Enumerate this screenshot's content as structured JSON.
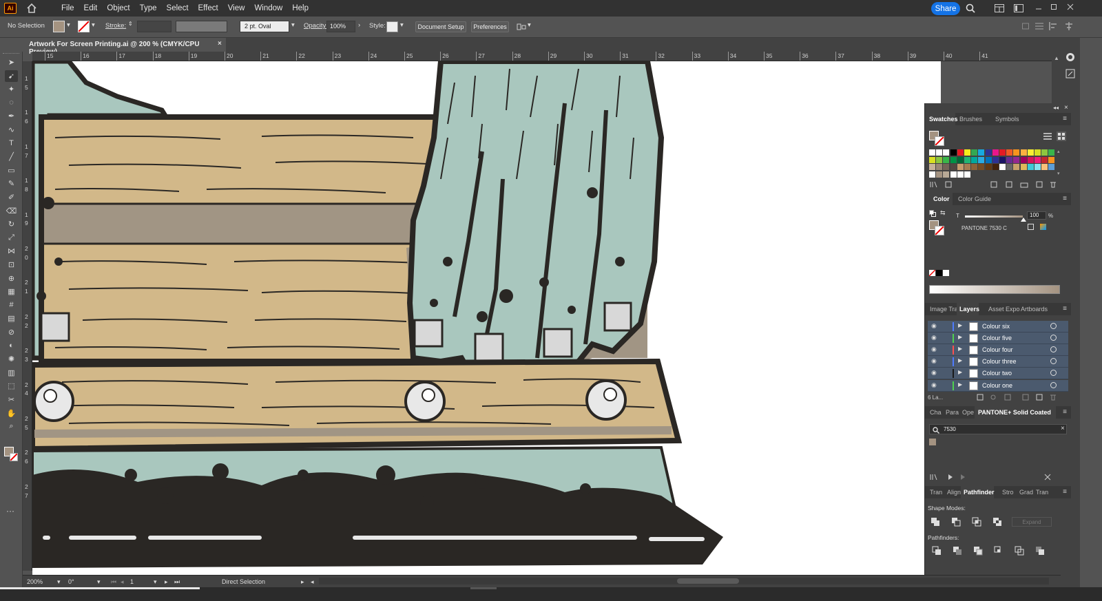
{
  "app": {
    "logo": "Ai",
    "share_label": "Share"
  },
  "menu": [
    "File",
    "Edit",
    "Object",
    "Type",
    "Select",
    "Effect",
    "View",
    "Window",
    "Help"
  ],
  "control_bar": {
    "selection": "No Selection",
    "stroke_label": "Stroke:",
    "brush": "2 pt. Oval",
    "opacity_label": "Opacity:",
    "opacity_value": "100%",
    "style_label": "Style:",
    "doc_setup": "Document Setup",
    "preferences": "Preferences"
  },
  "document_tab": {
    "title": "Artwork For Screen Printing.ai @ 200 % (CMYK/CPU Preview)",
    "close": "×"
  },
  "ruler_top": [
    "15",
    "16",
    "17",
    "18",
    "19",
    "20",
    "21",
    "22",
    "23",
    "24",
    "25",
    "26",
    "27",
    "28",
    "29",
    "30",
    "31",
    "32",
    "33",
    "34",
    "35",
    "36",
    "37",
    "38",
    "39",
    "40",
    "41"
  ],
  "ruler_left": [
    "1",
    "5",
    "1",
    "6",
    "1",
    "7",
    "1",
    "8",
    "1",
    "9",
    "2",
    "0",
    "2",
    "1",
    "2",
    "2",
    "2",
    "3",
    "2",
    "4",
    "2",
    "5",
    "2",
    "6",
    "2",
    "7"
  ],
  "tools": [
    "selection-tool",
    "direct-selection-tool",
    "magic-wand-tool",
    "lasso-tool",
    "pen-tool",
    "curvature-tool",
    "type-tool",
    "line-tool",
    "rectangle-tool",
    "paintbrush-tool",
    "blob-brush-tool",
    "eraser-tool",
    "rotate-tool",
    "scale-tool",
    "width-tool",
    "free-transform-tool",
    "shape-builder-tool",
    "perspective-grid-tool",
    "mesh-tool",
    "gradient-tool",
    "eyedropper-tool",
    "blend-tool",
    "symbol-sprayer-tool",
    "column-graph-tool",
    "artboard-tool",
    "slice-tool",
    "hand-tool",
    "zoom-tool"
  ],
  "swatches_panel": {
    "tabs": [
      "Swatches",
      "Brushes",
      "Symbols"
    ],
    "active_tab": "Swatches"
  },
  "color_panel": {
    "tabs": [
      "Color",
      "Color Guide"
    ],
    "tint_label": "T",
    "tint_value": "100",
    "tint_unit": "%",
    "color_name": "PANTONE 7530 C"
  },
  "layers_panel": {
    "tabs": [
      "Image Tra",
      "Layers",
      "Asset Expo",
      "Artboards"
    ],
    "active_tab": "Layers",
    "layers": [
      {
        "name": "Colour six",
        "color": "#4f7cff"
      },
      {
        "name": "Colour five",
        "color": "#4fd34f"
      },
      {
        "name": "Colour four",
        "color": "#ff4f4f"
      },
      {
        "name": "Colour three",
        "color": "#4f7cff"
      },
      {
        "name": "Colour two",
        "color": "#1a1a1a"
      },
      {
        "name": "Colour one",
        "color": "#4fd34f"
      }
    ],
    "count_label": "6 La..."
  },
  "pantone_panel": {
    "tabs": [
      "Cha",
      "Para",
      "Ope",
      "PANTONE+ Solid Coated"
    ],
    "search_value": "7530"
  },
  "pathfinder_panel": {
    "tabs": [
      "Tran",
      "Align",
      "Pathfinder",
      "Stro",
      "Grad",
      "Tran"
    ],
    "shape_modes_label": "Shape Modes:",
    "expand_label": "Expand",
    "pathfinders_label": "Pathfinders:"
  },
  "status_bar": {
    "zoom": "200%",
    "rotation": "0°",
    "artboard": "1",
    "tool": "Direct Selection"
  },
  "colors": {
    "plank": "#d2b889",
    "plank_shadow": "#a19584",
    "skin": "#a9c7be",
    "ink": "#2a2724",
    "white": "#ffffff"
  }
}
